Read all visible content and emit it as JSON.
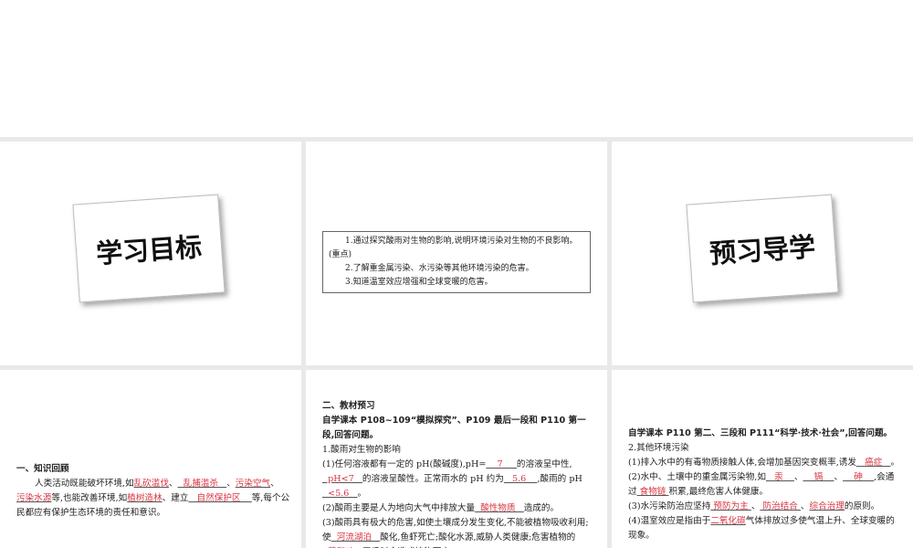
{
  "slide1": {
    "card_title": "学习目标"
  },
  "slide2": {
    "goals": [
      "1.通过探究酸雨对生物的影响,说明环境污染对生物的不良影响。(重点)",
      "2.了解重金属污染、水污染等其他环境污染的危害。",
      "3.知道温室效应增强和全球变暖的危害。"
    ]
  },
  "slide3": {
    "card_title": "预习导学"
  },
  "slide4": {
    "paras": [
      {
        "cls": "h",
        "segs": [
          {
            "t": "一、知识回顾"
          }
        ]
      },
      {
        "cls": "ind",
        "segs": [
          {
            "t": "人类活动既能破坏环境,如"
          },
          {
            "b": "乱砍滥伐"
          },
          {
            "t": "、"
          },
          {
            "b": "  乱捕滥杀   "
          },
          {
            "t": "、"
          },
          {
            "b": "污染空气"
          },
          {
            "t": "、"
          },
          {
            "b": "污染水源"
          },
          {
            "t": "等,也能改善环境,如"
          },
          {
            "b": "植树造林"
          },
          {
            "t": "、建立"
          },
          {
            "b": "   自然保护区    "
          },
          {
            "t": "等,每个公民都应有保护生态环境的责任和意识。"
          }
        ]
      }
    ]
  },
  "slide5": {
    "paras": [
      {
        "cls": "h",
        "segs": [
          {
            "t": "二、教材预习"
          }
        ]
      },
      {
        "cls": "h",
        "segs": [
          {
            "t": "自学课本 P108~109“模拟探究”、P109 最后一段和 P110 第一段,回答问题。"
          }
        ]
      },
      {
        "cls": "",
        "segs": [
          {
            "t": "1.酸雨对生物的影响"
          }
        ]
      },
      {
        "cls": "",
        "segs": [
          {
            "t": "(1)任何溶液都有一定的 pH(酸碱度),pH="
          },
          {
            "b": "    7     "
          },
          {
            "t": "的溶液呈中性,"
          },
          {
            "b": "  pH<7   "
          },
          {
            "t": "的溶液呈酸性。正常雨水的 pH 约为"
          },
          {
            "b": "   5.6    "
          },
          {
            "t": ",酸雨的 pH"
          },
          {
            "b": "  <5.6   "
          },
          {
            "t": "。"
          }
        ]
      },
      {
        "cls": "",
        "segs": [
          {
            "t": "(2)酸雨主要是人为地向大气中排放大量"
          },
          {
            "b": "  酸性物质   "
          },
          {
            "t": "造成的。"
          }
        ]
      },
      {
        "cls": "",
        "segs": [
          {
            "t": "(3)酸雨具有极大的危害,如使土壤成分发生变化,不能被植物吸收利用;使"
          },
          {
            "b": "  河流湖泊   "
          },
          {
            "t": "酸化,鱼虾死亡;酸化水源,威胁人类健康;危害植物的"
          },
          {
            "b": "  芽和叶  "
          },
          {
            "t": ",严重时会造成植物死亡。"
          }
        ]
      }
    ]
  },
  "slide6": {
    "paras": [
      {
        "cls": "h",
        "segs": [
          {
            "t": "自学课本 P110 第二、三段和 P111“科学·技术·社会”,回答问题。"
          }
        ]
      },
      {
        "cls": "",
        "segs": [
          {
            "t": "2.其他环境污染"
          }
        ]
      },
      {
        "cls": "",
        "segs": [
          {
            "t": "(1)排入水中的有毒物质接触人体,会增加基因突变概率,诱发"
          },
          {
            "b": "   癌症   "
          },
          {
            "t": "。"
          }
        ]
      },
      {
        "cls": "",
        "segs": [
          {
            "t": "(2)水中、土壤中的重金属污染物,如"
          },
          {
            "b": "   汞    "
          },
          {
            "t": "、"
          },
          {
            "b": "    镉    "
          },
          {
            "t": "、"
          },
          {
            "b": "    砷    "
          },
          {
            "t": ",会通过"
          },
          {
            "b": " 食物链 "
          },
          {
            "t": "积累,最终危害人体健康。"
          }
        ]
      },
      {
        "cls": "",
        "segs": [
          {
            "t": "(3)水污染防治应坚持"
          },
          {
            "b": " 预防为主 "
          },
          {
            "t": "、"
          },
          {
            "b": " 防治结合 "
          },
          {
            "t": "、"
          },
          {
            "b": "综合治理"
          },
          {
            "t": "的原则。"
          }
        ]
      },
      {
        "cls": "",
        "segs": [
          {
            "t": "(4)温室效应是指由于"
          },
          {
            "b": "二氧化碳"
          },
          {
            "t": "气体排放过多使气温上升、全球变暖的现象。"
          }
        ]
      }
    ]
  }
}
